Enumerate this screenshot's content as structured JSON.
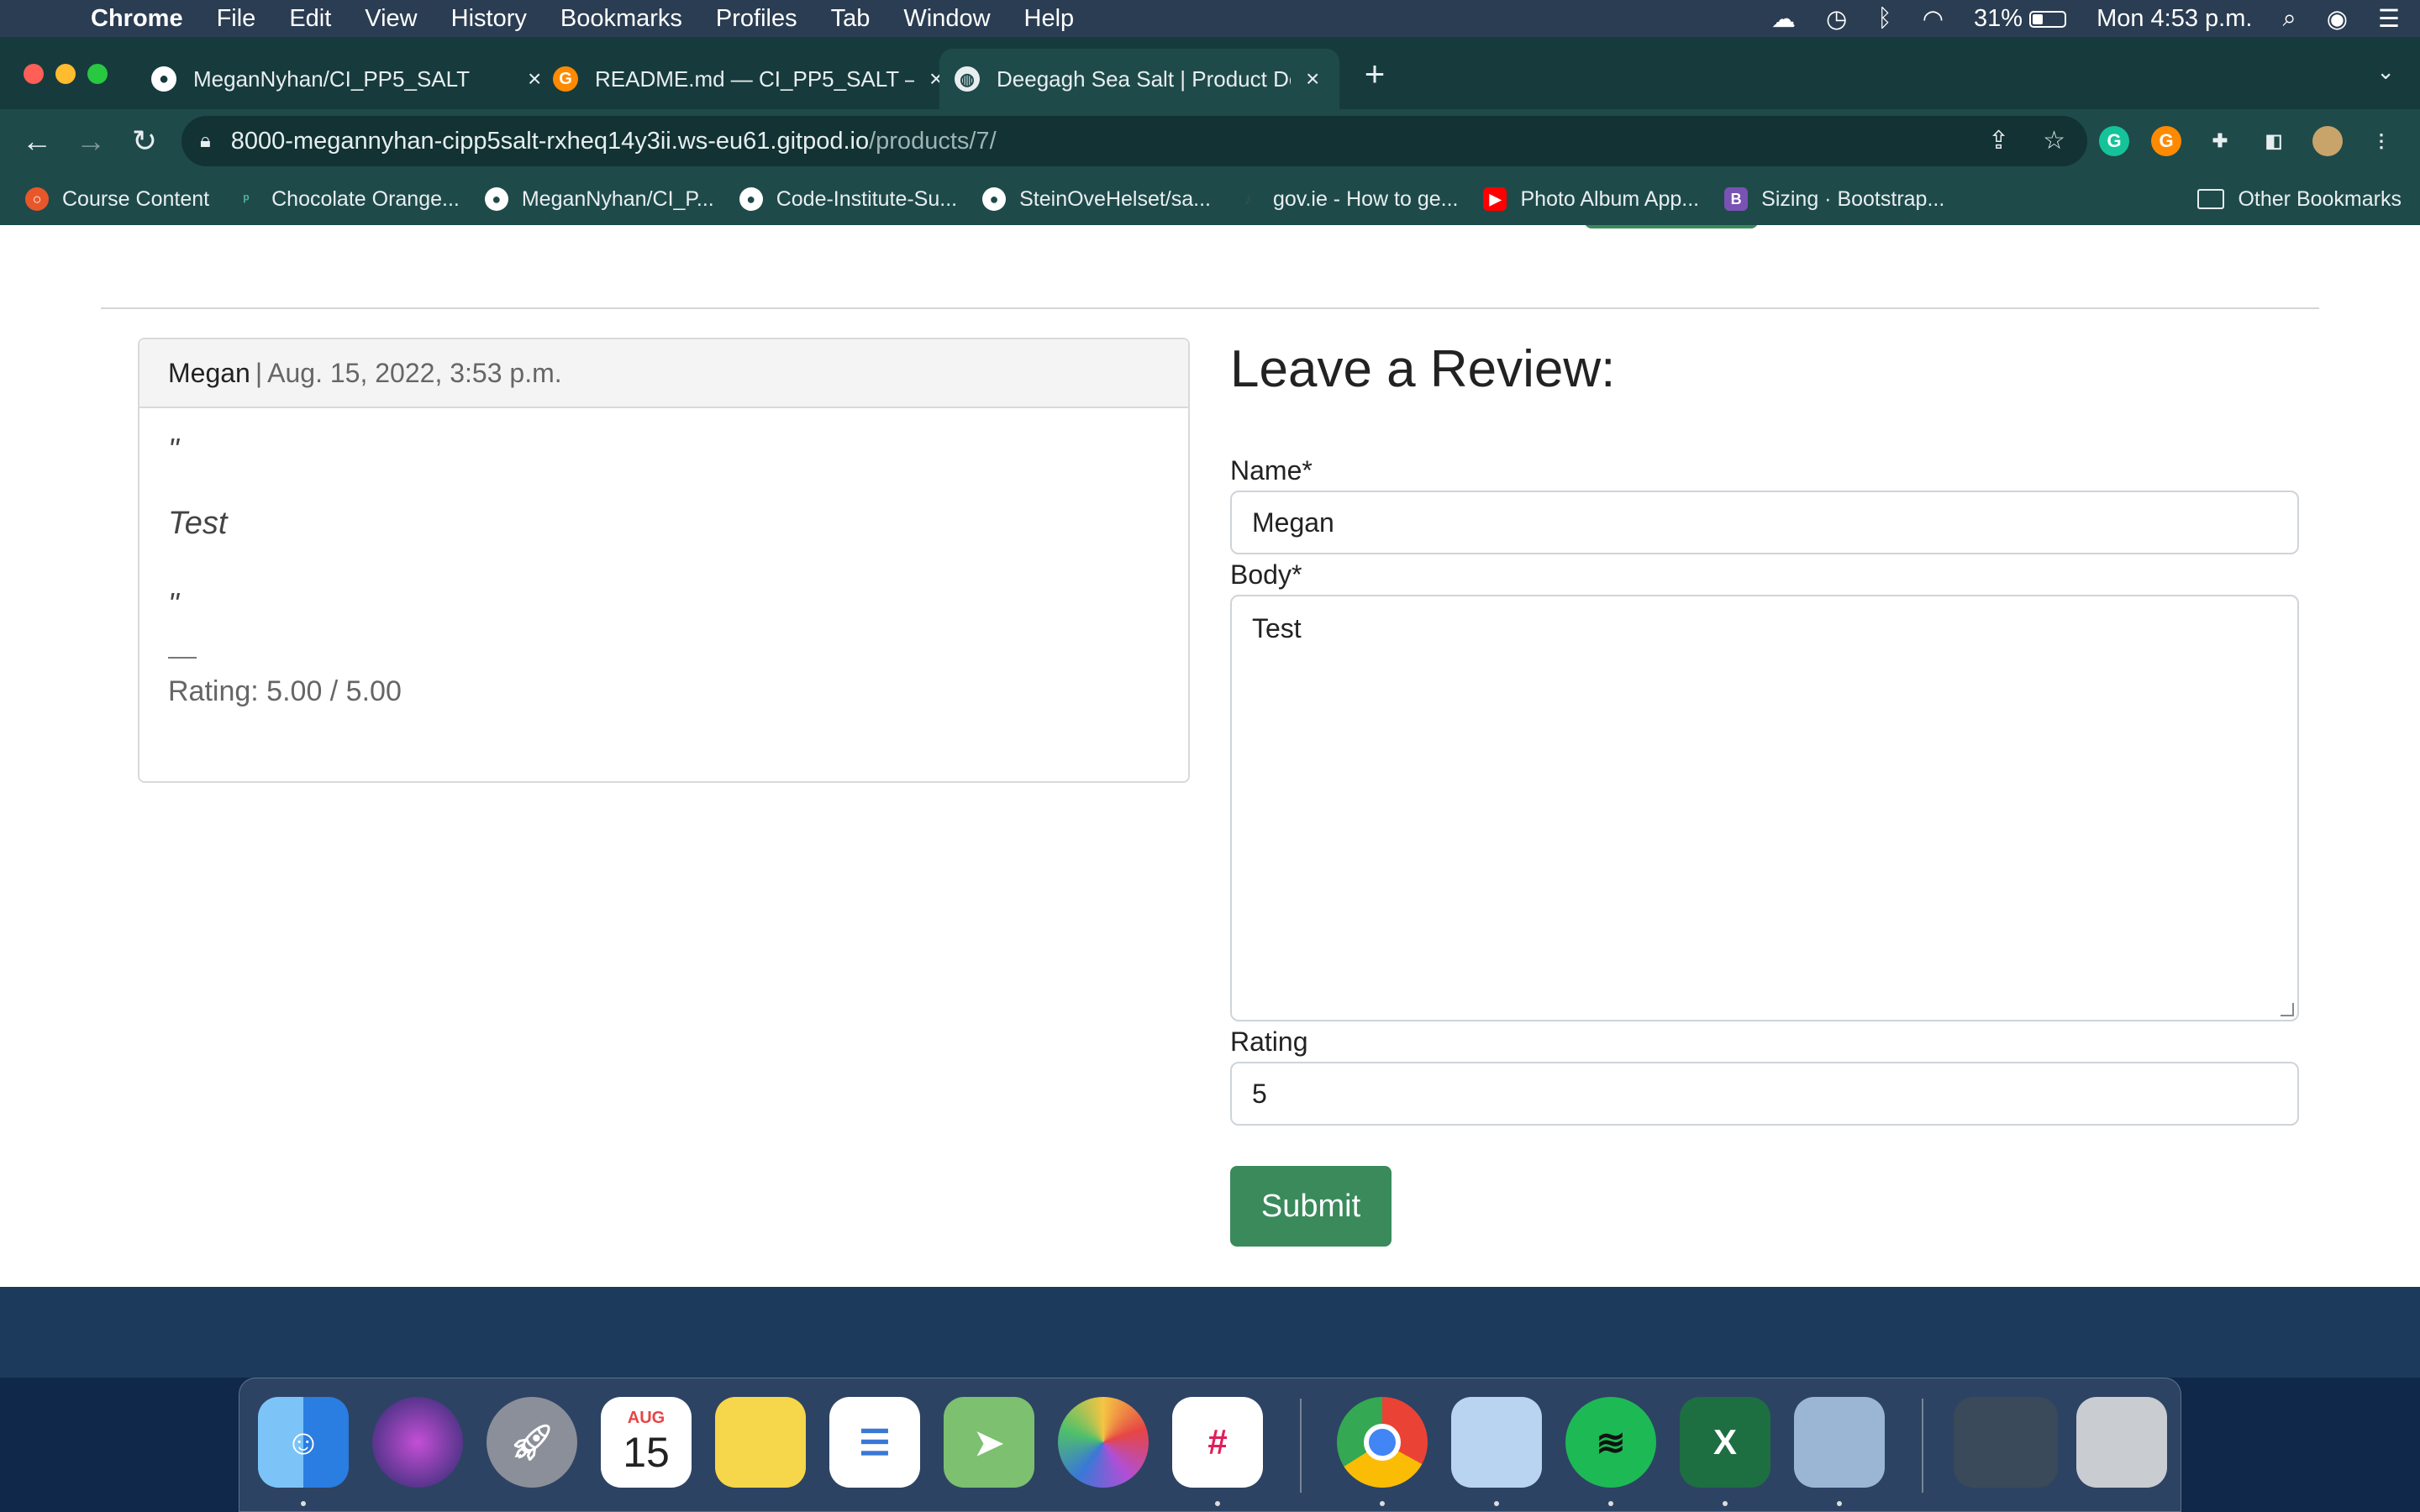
{
  "menubar": {
    "app": "Chrome",
    "items": [
      "File",
      "Edit",
      "View",
      "History",
      "Bookmarks",
      "Profiles",
      "Tab",
      "Window",
      "Help"
    ],
    "battery": "31%",
    "clock": "Mon 4:53 p.m."
  },
  "tabs": [
    {
      "title": "MeganNyhan/CI_PP5_SALT",
      "icon": "github-icon",
      "active": false
    },
    {
      "title": "README.md — CI_PP5_SALT –",
      "icon": "gitpod-icon",
      "active": false
    },
    {
      "title": "Deegagh Sea Salt | Product De",
      "icon": "globe-icon",
      "active": true
    }
  ],
  "address": {
    "host": "8000-megannyhan-cipp5salt-rxheq14y3ii.ws-eu61.gitpod.io",
    "path": "/products/7/"
  },
  "bookmarks": [
    {
      "label": "Course Content",
      "icon": "course-icon",
      "color": "#e8572a"
    },
    {
      "label": "Chocolate Orange...",
      "icon": "bookmark-icon",
      "color": "#4fb3a0"
    },
    {
      "label": "MeganNyhan/CI_P...",
      "icon": "github-icon",
      "color": "#ffffff"
    },
    {
      "label": "Code-Institute-Su...",
      "icon": "github-icon",
      "color": "#ffffff"
    },
    {
      "label": "SteinOveHelset/sa...",
      "icon": "github-icon",
      "color": "#ffffff"
    },
    {
      "label": "gov.ie - How to ge...",
      "icon": "harp-icon",
      "color": "#3a5050"
    },
    {
      "label": "Photo Album App...",
      "icon": "youtube-icon",
      "color": "#ff0000"
    },
    {
      "label": "Sizing · Bootstrap...",
      "icon": "bootstrap-icon",
      "color": "#7952b3"
    }
  ],
  "other_bookmarks": "Other Bookmarks",
  "review": {
    "author": "Megan",
    "separator": "|",
    "date": "Aug. 15, 2022, 3:53 p.m.",
    "open_quote": "\"",
    "body": "Test",
    "close_quote": "\"",
    "rating": "Rating: 5.00 / 5.00"
  },
  "form": {
    "title": "Leave a Review:",
    "name_label": "Name*",
    "name_value": "Megan",
    "body_label": "Body*",
    "body_value": "Test",
    "rating_label": "Rating",
    "rating_value": "5",
    "submit": "Submit"
  },
  "dock": [
    {
      "name": "finder-icon",
      "color": "#3b9ef0"
    },
    {
      "name": "siri-icon",
      "color": "#5a3fd6"
    },
    {
      "name": "launchpad-icon",
      "color": "#8a8f99"
    },
    {
      "name": "calendar-icon",
      "color": "#ffffff"
    },
    {
      "name": "notes-icon",
      "color": "#f6d64a"
    },
    {
      "name": "reminders-icon",
      "color": "#ffffff"
    },
    {
      "name": "maps-icon",
      "color": "#7cc070"
    },
    {
      "name": "photos-icon",
      "color": "#f4f4f4"
    },
    {
      "name": "slack-icon",
      "color": "#ffffff"
    },
    {
      "name": "chrome-icon",
      "color": "#ffffff"
    },
    {
      "name": "mail-stamp-icon",
      "color": "#b9d4f0"
    },
    {
      "name": "spotify-icon",
      "color": "#1db954"
    },
    {
      "name": "excel-icon",
      "color": "#1d6f42"
    },
    {
      "name": "preview-icon",
      "color": "#9ab6d4"
    },
    {
      "name": "screenshot-icon",
      "color": "#3a4a5a"
    },
    {
      "name": "trash-icon",
      "color": "#c9ccd0"
    }
  ],
  "calendar_month": "AUG",
  "calendar_day": "15"
}
